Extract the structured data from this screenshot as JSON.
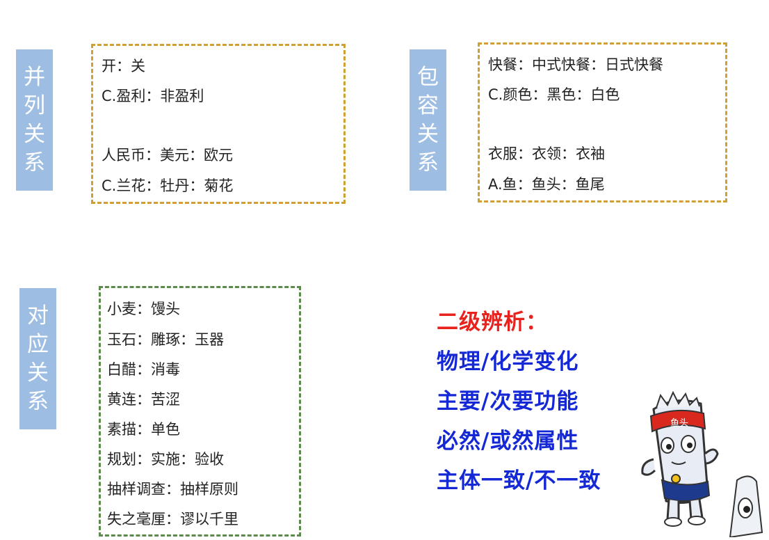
{
  "sections": {
    "parallel": {
      "label_chars": [
        "并",
        "列",
        "关",
        "系"
      ],
      "lines": [
        "开：关",
        "C.盈利：非盈利",
        "人民币：美元：欧元",
        "C.兰花：牡丹：菊花"
      ]
    },
    "inclusion": {
      "label_chars": [
        "包",
        "容",
        "关",
        "系"
      ],
      "lines": [
        "快餐：中式快餐：日式快餐",
        "C.颜色：黑色：白色",
        "衣服：衣领：衣袖",
        "A.鱼：鱼头：鱼尾"
      ]
    },
    "correspondence": {
      "label_chars": [
        "对",
        "应",
        "关",
        "系"
      ],
      "lines": [
        "小麦：馒头",
        "玉石：雕琢：玉器",
        "白醋：消毒",
        "黄连：苦涩",
        "素描：单色",
        "规划：实施：验收",
        "抽样调查：抽样原则",
        "失之毫厘：谬以千里"
      ]
    }
  },
  "analysis": {
    "title": "二级辨析：",
    "items": [
      "物理/化学变化",
      "主要/次要功能",
      "必然/或然属性",
      "主体一致/不一致"
    ]
  },
  "mascot": {
    "icon": "cartoon-mascot-icon",
    "headband_text": "鱼头"
  },
  "colors": {
    "label_bg": "#9dbde3",
    "orange_dash": "#d29f33",
    "green_dash": "#5b8a4a",
    "analysis_title": "#e8231d",
    "analysis_items": "#1428d6"
  }
}
